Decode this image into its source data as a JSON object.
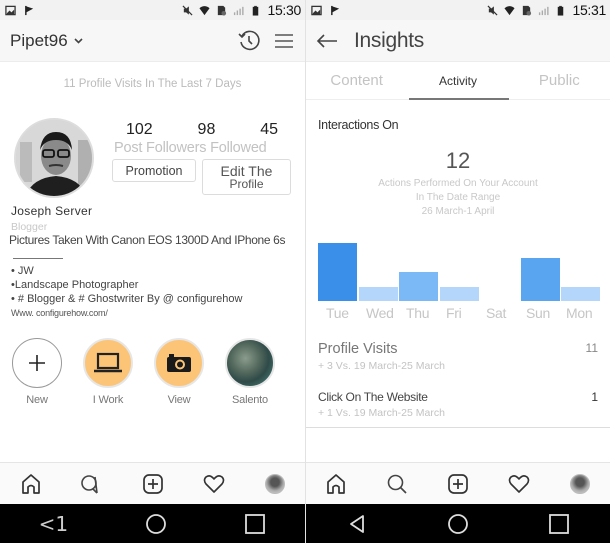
{
  "left": {
    "status": {
      "time": "15:30"
    },
    "header": {
      "username": "Pipet96",
      "dropdown_icon": "chevron-down-icon",
      "history_icon": "history-icon",
      "menu_icon": "hamburger-menu-icon"
    },
    "visits_banner": "11 Profile Visits In The Last 7 Days",
    "stats": {
      "posts": "102",
      "followers": "98",
      "followed": "45",
      "labels": "Post Followers Followed"
    },
    "buttons": {
      "promotion": "Promotion",
      "edit_line1": "Edit The",
      "edit_line2": "Profile"
    },
    "bio": {
      "name": "Joseph Server",
      "category": "Blogger",
      "line1": "Pictures Taken With Canon EOS 1300D And IPhone 6s",
      "line2": "• JW",
      "line3": "•Landscape Photographer",
      "line4": "• # Blogger & # Ghostwriter By @ configurehow",
      "url": "Www. configurehow.com/"
    },
    "highlights": [
      {
        "label": "New",
        "icon": "plus-icon"
      },
      {
        "label": "I Work",
        "icon": "laptop-icon"
      },
      {
        "label": "View",
        "icon": "camera-icon"
      },
      {
        "label": "Salento",
        "icon": "photo-thumbnail"
      }
    ],
    "sysnav": {
      "back_label": "<1"
    }
  },
  "right": {
    "status": {
      "time": "15:31"
    },
    "header": {
      "title": "Insights",
      "back_icon": "arrow-left-icon"
    },
    "tabs": [
      {
        "label": "Content",
        "active": false
      },
      {
        "label": "Activity",
        "active": true
      },
      {
        "label": "Public",
        "active": false
      }
    ],
    "section_title": "Interactions On",
    "total": "12",
    "note_line1": "Actions Performed On Your Account",
    "note_line2": "In The Date Range",
    "note_line3": "26 March-1 April",
    "metrics": [
      {
        "title": "Profile Visits",
        "value": "11",
        "sub": "+ 3 Vs. 19 March-25 March"
      },
      {
        "title": "Click On The Website",
        "value": "1",
        "sub": "+ 1 Vs. 19 March-25 March"
      }
    ]
  },
  "colors": {
    "bar_dark": "#3a8fe8",
    "bar_mid": "#7bb9f6",
    "bar_light": "#b3d6fa",
    "highlight_orange": "#fcc477"
  },
  "chart_data": {
    "type": "bar",
    "title": "Interactions On",
    "categories": [
      "Tue",
      "Wed",
      "Thu",
      "Fri",
      "Sat",
      "Sun",
      "Mon"
    ],
    "values": [
      4,
      1,
      2,
      1,
      0,
      3,
      1
    ],
    "xlabel": "",
    "ylabel": "",
    "ylim": [
      0,
      4
    ],
    "grid": false
  }
}
